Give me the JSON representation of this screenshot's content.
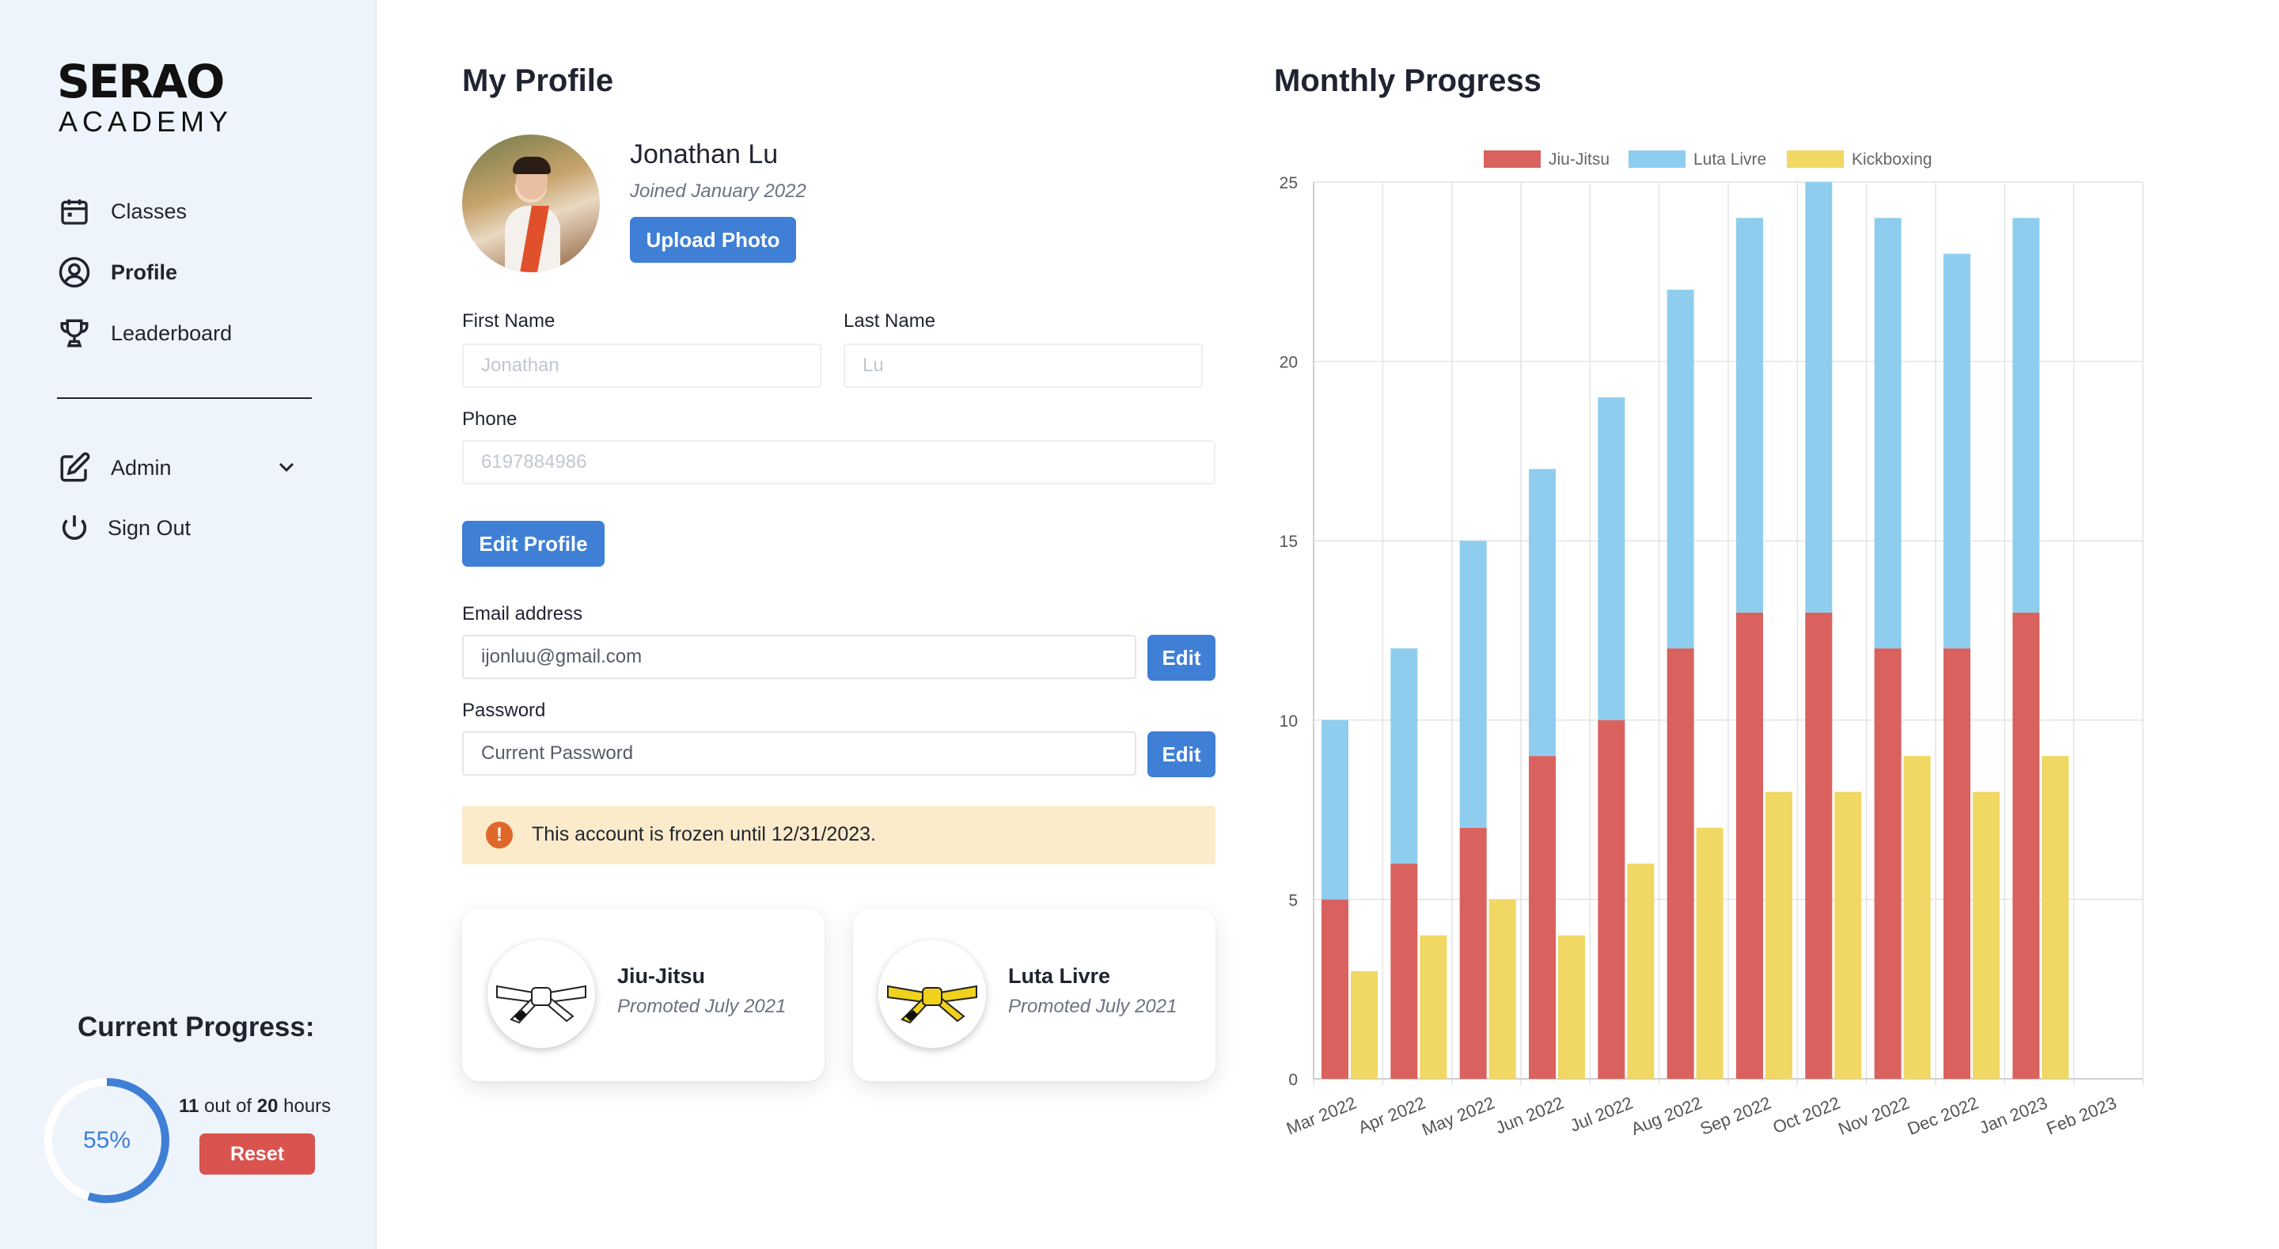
{
  "sidebar": {
    "logo": {
      "top": "SERAO",
      "bottom": "ACADEMY"
    },
    "nav": [
      {
        "label": "Classes",
        "icon": "calendar-icon"
      },
      {
        "label": "Profile",
        "icon": "user-circle-icon"
      },
      {
        "label": "Leaderboard",
        "icon": "trophy-icon"
      }
    ],
    "admin": {
      "label": "Admin",
      "icon": "edit-icon"
    },
    "signout": {
      "label": "Sign Out",
      "icon": "power-icon"
    },
    "progress": {
      "title": "Current Progress:",
      "percent_label": "55%",
      "percent": 55,
      "completed": "11",
      "total": "20",
      "hours_mid": "out of",
      "hours_suffix": "hours",
      "reset_label": "Reset"
    }
  },
  "profile": {
    "heading": "My Profile",
    "name": "Jonathan Lu",
    "joined": "Joined January 2022",
    "upload_label": "Upload Photo",
    "first_name_label": "First Name",
    "first_name_placeholder": "Jonathan",
    "last_name_label": "Last Name",
    "last_name_placeholder": "Lu",
    "phone_label": "Phone",
    "phone_placeholder": "6197884986",
    "edit_profile_label": "Edit Profile",
    "email_label": "Email address",
    "email_value": "ijonluu@gmail.com",
    "password_label": "Password",
    "password_placeholder": "Current Password",
    "edit_label": "Edit",
    "alert_text": "This account is frozen until 12/31/2023.",
    "belts": [
      {
        "name": "Jiu-Jitsu",
        "date": "Promoted July 2021",
        "color": "#ffffff"
      },
      {
        "name": "Luta Livre",
        "date": "Promoted July 2021",
        "color": "#f0d11c"
      }
    ]
  },
  "chart": {
    "heading": "Monthly Progress"
  },
  "colors": {
    "accent": "#3f7fd6",
    "danger": "#d9534f",
    "alert_bg": "#fbebcb",
    "jiujitsu": "#d9625e",
    "lutalivre": "#8fcdee",
    "kickboxing": "#f1d764"
  },
  "chart_data": {
    "type": "bar",
    "title": "Monthly Progress",
    "categories": [
      "Mar 2022",
      "Apr 2022",
      "May 2022",
      "Jun 2022",
      "Jul 2022",
      "Aug 2022",
      "Sep 2022",
      "Oct 2022",
      "Nov 2022",
      "Dec 2022",
      "Jan 2023",
      "Feb 2023"
    ],
    "stacked_series": [
      "Jiu-Jitsu",
      "Luta Livre"
    ],
    "series": [
      {
        "name": "Jiu-Jitsu",
        "color": "#d9625e",
        "values": [
          5,
          6,
          7,
          9,
          10,
          12,
          13,
          13,
          12,
          12,
          13,
          0
        ]
      },
      {
        "name": "Luta Livre",
        "color": "#8fcdee",
        "values": [
          5,
          6,
          8,
          8,
          9,
          10,
          11,
          12,
          12,
          11,
          11,
          0
        ]
      },
      {
        "name": "Kickboxing",
        "color": "#f1d764",
        "values": [
          3,
          4,
          5,
          4,
          6,
          7,
          8,
          8,
          9,
          8,
          9,
          0
        ]
      }
    ],
    "yticks": [
      "0",
      "5",
      "10",
      "15",
      "20",
      "25"
    ],
    "ylim": [
      0,
      25
    ],
    "legend": "top",
    "grid": true
  }
}
